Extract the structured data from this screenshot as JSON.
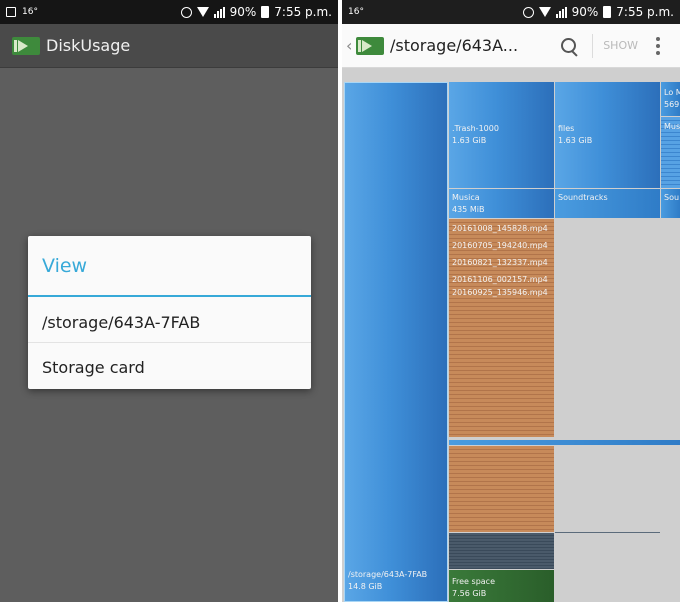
{
  "left": {
    "status": {
      "time": "7:55 p.m.",
      "battery": "90%",
      "temp": "16°"
    },
    "app": {
      "title": "DiskUsage"
    },
    "dialog": {
      "title": "View",
      "items": [
        {
          "label": "/storage/643A-7FAB"
        },
        {
          "label": "Storage card"
        }
      ]
    }
  },
  "right": {
    "status": {
      "time": "7:55 p.m.",
      "battery": "90%",
      "temp": "16°"
    },
    "toolbar": {
      "path": "/storage/643A...",
      "show_label": "SHOW"
    },
    "treemap": {
      "root": {
        "name": "/storage/643A-7FAB",
        "size": "14.8 GiB"
      },
      "trash": {
        "name": ".Trash-1000",
        "size": "1.63 GiB"
      },
      "files": {
        "name": "files",
        "size": "1.63 GiB"
      },
      "lo": {
        "name": "Lo M",
        "size": "569"
      },
      "mus_small": {
        "name": "Mus"
      },
      "musica": {
        "name": "Musica",
        "size": "435 MiB"
      },
      "soundtracks": {
        "name": "Soundtracks"
      },
      "sou": {
        "name": "Sou"
      },
      "videos": [
        {
          "name": "20161008_145828.mp4"
        },
        {
          "name": "20160705_194240.mp4"
        },
        {
          "name": "20160821_132337.mp4"
        },
        {
          "name": "20161106_002157.mp4"
        },
        {
          "name": "20160925_135946.mp4"
        }
      ],
      "free": {
        "name": "Free space",
        "size": "7.56 GiB"
      }
    },
    "colors": {
      "accent": "#37a9d8",
      "dir": "#3f8fd8",
      "file": "#c78a5a",
      "free": "#3a7a3a"
    }
  }
}
